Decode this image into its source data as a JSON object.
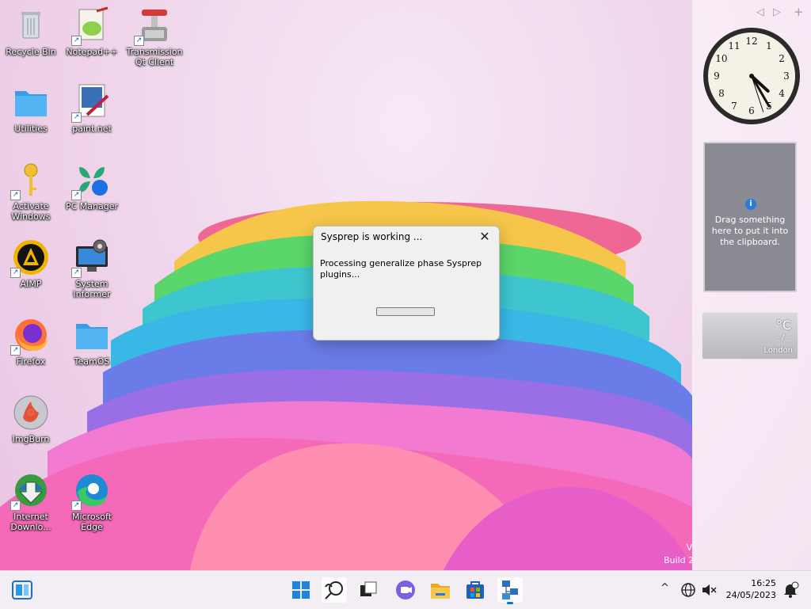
{
  "desktop": {
    "icons": [
      {
        "label": "Recycle Bin",
        "icon": "recycle-bin-icon"
      },
      {
        "label": "Notepad++",
        "icon": "notepadpp-icon"
      },
      {
        "label": "Transmission Qt Client",
        "icon": "transmission-icon"
      },
      {
        "label": "Utilities",
        "icon": "folder-icon"
      },
      {
        "label": "paint.net",
        "icon": "paintnet-icon"
      },
      {
        "label": "Activate Windows",
        "icon": "key-icon"
      },
      {
        "label": "PC Manager",
        "icon": "pc-manager-icon"
      },
      {
        "label": "AIMP",
        "icon": "aimp-icon"
      },
      {
        "label": "System Informer",
        "icon": "system-informer-icon"
      },
      {
        "label": "Firefox",
        "icon": "firefox-icon"
      },
      {
        "label": "TeamOS",
        "icon": "folder-icon"
      },
      {
        "label": "ImgBurn",
        "icon": "imgburn-icon"
      },
      {
        "label": "Internet Downlo...",
        "icon": "idm-icon"
      },
      {
        "label": "Microsoft Edge",
        "icon": "edge-icon"
      }
    ]
  },
  "dialog": {
    "title": "Sysprep is working ...",
    "close_glyph": "✕",
    "message": "Processing generalize phase Sysprep plugins...",
    "progress": 0
  },
  "sidebar": {
    "nav_prev": "◁",
    "nav_next": "▷",
    "add": "+",
    "clock": {
      "hour": 4,
      "minute": 25,
      "second": 27
    },
    "clipboard_text": "Drag something here to put it into the clipboard.",
    "clipboard_info": "i",
    "weather": {
      "degree": "°C",
      "value": "- / -",
      "city": "London"
    }
  },
  "watermark": {
    "line1": "V",
    "line2": "Build 2"
  },
  "taskbar": {
    "time": "16:25",
    "date": "24/05/2023",
    "chevron": "^",
    "items": [
      "start-icon",
      "search-icon",
      "task-view-icon",
      "chat-icon",
      "file-explorer-icon",
      "store-icon",
      "network-app-icon"
    ]
  },
  "colors": {
    "accent": "#0078d4",
    "dialog_bg": "#f0f0f0",
    "taskbar_bg": "#f3eef3"
  }
}
